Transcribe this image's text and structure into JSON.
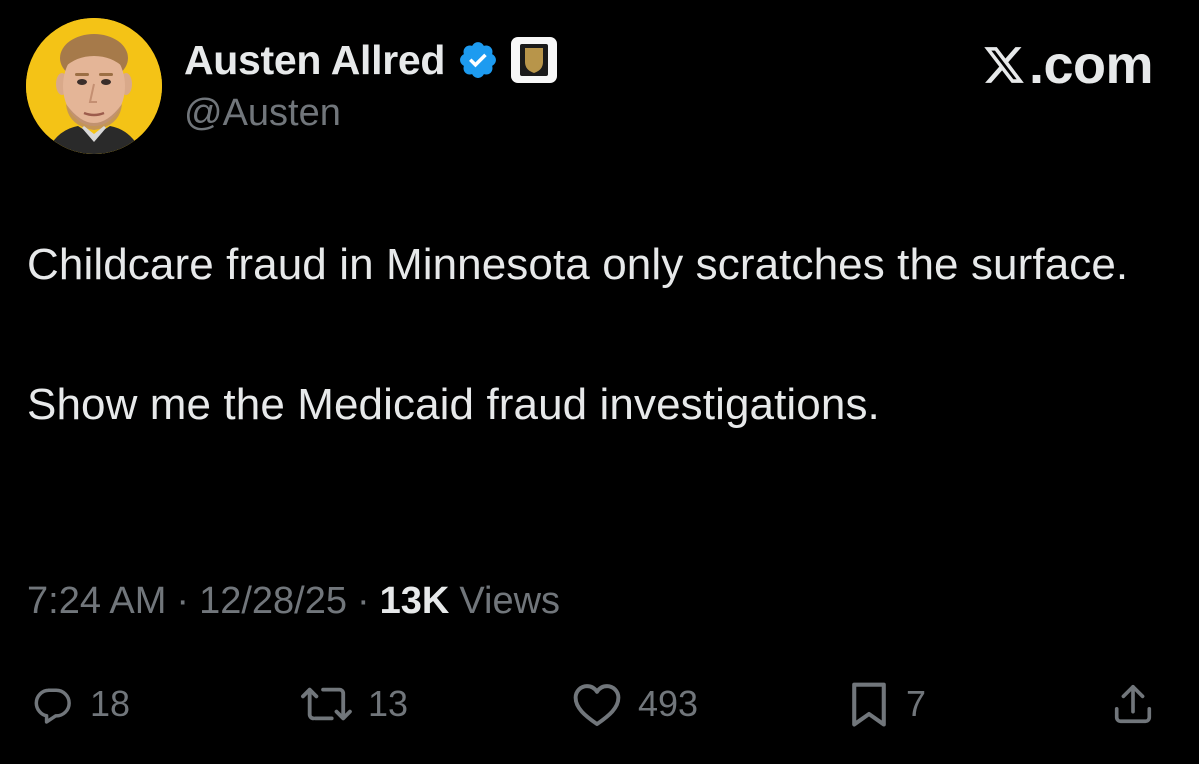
{
  "author": {
    "display_name": "Austen Allred",
    "handle": "@Austen",
    "verified": true,
    "avatar_background": "#f4c316"
  },
  "brand": {
    "label": ".com"
  },
  "tweet": {
    "text": "Childcare fraud in Minnesota only scratches the surface.\n\nShow me the Medicaid fraud investigations."
  },
  "meta": {
    "time": "7:24 AM",
    "date": "12/28/25",
    "separator": "·",
    "views_count": "13K",
    "views_label": "Views"
  },
  "actions": {
    "reply": {
      "icon": "reply-icon",
      "count": "18"
    },
    "repost": {
      "icon": "repost-icon",
      "count": "13"
    },
    "like": {
      "icon": "heart-icon",
      "count": "493"
    },
    "bookmark": {
      "icon": "bookmark-icon",
      "count": "7"
    },
    "share": {
      "icon": "share-icon"
    }
  },
  "colors": {
    "background": "#000000",
    "primary_text": "#e7e9ea",
    "secondary_text": "#71767b",
    "verified_blue": "#1d9bf0",
    "affiliate_gold": "#b8954a"
  }
}
